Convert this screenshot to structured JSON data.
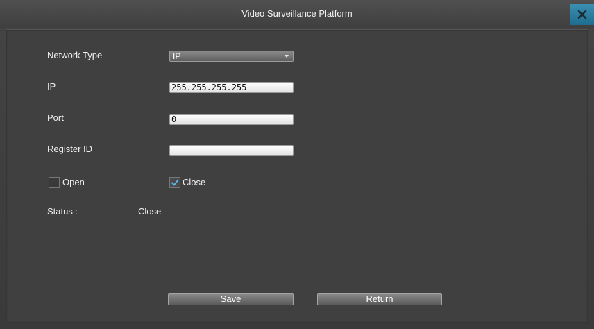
{
  "window": {
    "title": "Video Surveillance Platform"
  },
  "form": {
    "network_type_label": "Network Type",
    "network_type_value": "IP",
    "ip_label": "IP",
    "ip_value": "255.255.255.255",
    "port_label": "Port",
    "port_value": "0",
    "register_id_label": "Register ID",
    "register_id_value": "",
    "open_label": "Open",
    "open_checked": false,
    "close_label": "Close",
    "close_checked": true,
    "status_label": "Status :",
    "status_value": "Close"
  },
  "buttons": {
    "save_label": "Save",
    "return_label": "Return"
  },
  "colors": {
    "close_button": "#2a7fa0",
    "check_mark": "#5ab4e6"
  },
  "icons": {
    "close": "close-icon",
    "dropdown": "chevron-down-icon",
    "check": "checkmark-icon"
  }
}
